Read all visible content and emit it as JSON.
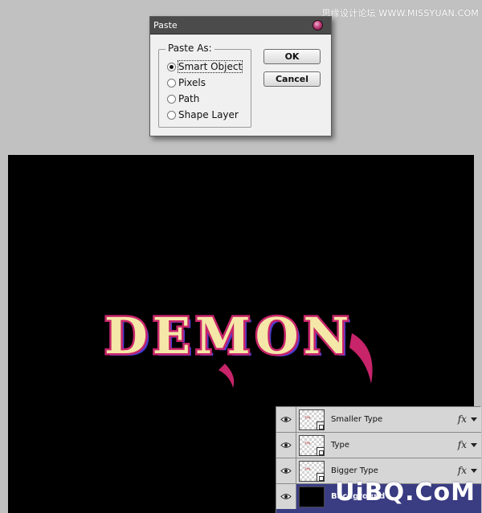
{
  "watermark_top": "思缘设计论坛 WWW.MISSYUAN.COM",
  "dialog": {
    "title": "Paste",
    "fieldset_label": "Paste As:",
    "options": [
      {
        "label": "Smart Object",
        "checked": true
      },
      {
        "label": "Pixels",
        "checked": false
      },
      {
        "label": "Path",
        "checked": false
      },
      {
        "label": "Shape Layer",
        "checked": false
      }
    ],
    "ok_label": "OK",
    "cancel_label": "Cancel"
  },
  "canvas": {
    "text": "DEMON",
    "background": "#000000",
    "text_fill": "#f5e7a8",
    "text_outline": "#c8246a",
    "text_shadow": "#4b3bd0"
  },
  "layers": [
    {
      "name": "Smaller Type",
      "has_fx": true,
      "visible": true
    },
    {
      "name": "Type",
      "has_fx": true,
      "visible": true
    },
    {
      "name": "Bigger Type",
      "has_fx": true,
      "visible": true
    },
    {
      "name": "Background",
      "has_fx": false,
      "visible": true,
      "selected": true
    }
  ],
  "fx_symbol": "fx",
  "watermark_bottom": "UiBQ.CoM"
}
